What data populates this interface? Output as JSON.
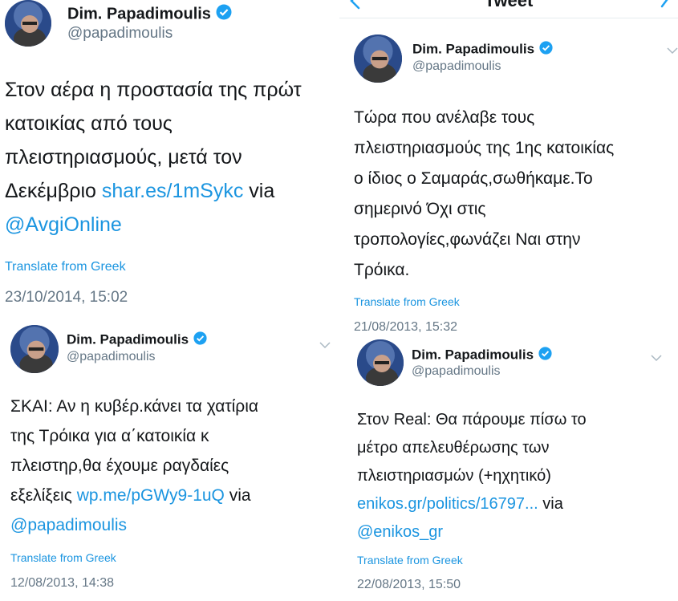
{
  "nav": {
    "title": "Tweet"
  },
  "colors": {
    "link": "#1b95e0",
    "muted": "#657786",
    "verified": "#1da1f2"
  },
  "tweets": [
    {
      "name": "Dim. Papadimoulis",
      "handle": "@papadimoulis",
      "text_plain": "Στον αέρα η προστασία της πρώτ\nκατοικίας από τους\nπλειστηριασμούς, μετά τον\nΔεκέμβριο ",
      "link": "shar.es/1mSykc",
      "via": " via",
      "mention": "@AvgiOnline",
      "translate": "Translate from Greek",
      "date": "23/10/2014, 15:02"
    },
    {
      "name": "Dim. Papadimoulis",
      "handle": "@papadimoulis",
      "text_plain": "Τώρα που ανέλαβε τους\nπλειστηριασμούς της 1ης κατοικίας\nο ίδιος ο Σαμαράς,σωθήκαμε.Το\nσημερινό Όχι στις\nτροπολογίες,φωνάζει Ναι στην\nΤρόικα.",
      "translate": "Translate from Greek",
      "date": "21/08/2013, 15:32"
    },
    {
      "name": "Dim. Papadimoulis",
      "handle": "@papadimoulis",
      "text_plain": "ΣΚΑΙ: Αν η κυβέρ.κάνει τα χατίρια\nτης Τρόικα για α΄κατοικία κ\nπλειστηρ,θα έχουμε ραγδαίες\nεξελίξεις ",
      "link": "wp.me/pGWy9-1uQ",
      "via": " via",
      "mention": "@papadimoulis",
      "translate": "Translate from Greek",
      "date": "12/08/2013, 14:38"
    },
    {
      "name": "Dim. Papadimoulis",
      "handle": "@papadimoulis",
      "text_plain": "Στον Real: Θα πάρουμε πίσω το\nμέτρο απελευθέρωσης των\nπλειστηριασμών (+ηχητικό)\n",
      "link": "enikos.gr/politics/16797...",
      "via": " via",
      "mention": "@enikos_gr",
      "translate": "Translate from Greek",
      "date": "22/08/2013, 15:50"
    }
  ]
}
